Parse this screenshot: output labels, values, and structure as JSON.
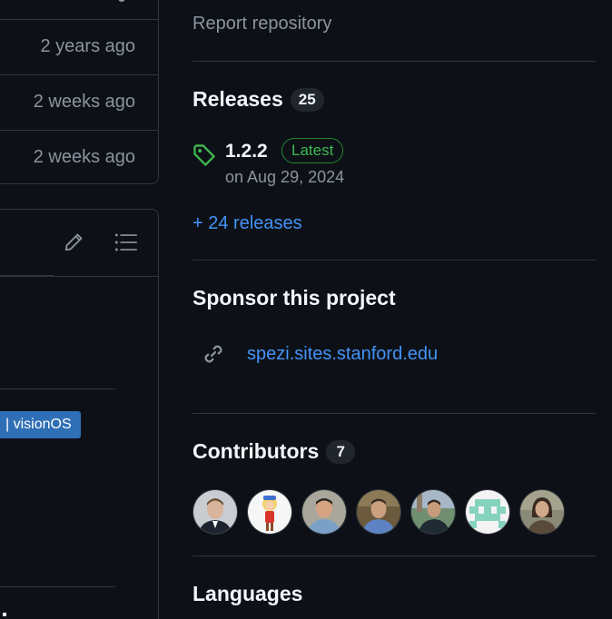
{
  "file_list": {
    "rows": [
      {
        "age": "2 years ago"
      },
      {
        "age": "2 weeks ago"
      },
      {
        "age": "2 weeks ago"
      }
    ]
  },
  "readme": {
    "badge_visionos": "| visionOS",
    "icons": [
      "pencil-icon",
      "list-icon"
    ]
  },
  "sidebar": {
    "report_repository": "Report repository",
    "releases": {
      "title": "Releases",
      "count": "25",
      "latest": {
        "version": "1.2.2",
        "badge": "Latest",
        "date": "on Aug 29, 2024"
      },
      "more_link": "+ 24 releases"
    },
    "sponsor": {
      "title": "Sponsor this project",
      "url": "spezi.sites.stanford.edu"
    },
    "contributors": {
      "title": "Contributors",
      "count": "7",
      "avatars": [
        "avatar-1",
        "avatar-2",
        "avatar-3",
        "avatar-4",
        "avatar-5",
        "avatar-6",
        "avatar-7"
      ]
    },
    "languages": {
      "title": "Languages"
    }
  },
  "colors": {
    "background": "#0d1117",
    "border": "#30363d",
    "text_primary": "#f0f6fc",
    "text_muted": "#8b949e",
    "link": "#4493f8",
    "latest_green": "#3fb950",
    "badge_blue": "#2f6fb6"
  }
}
